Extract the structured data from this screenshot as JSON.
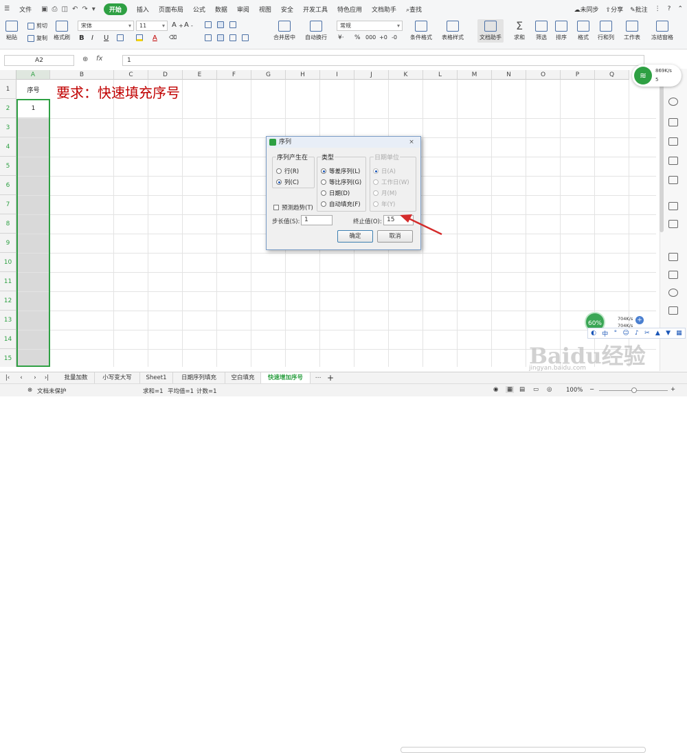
{
  "menubar": {
    "file": "文件",
    "tabs": [
      "开始",
      "插入",
      "页面布局",
      "公式",
      "数据",
      "审阅",
      "视图",
      "安全",
      "开发工具",
      "特色应用",
      "文档助手"
    ],
    "search": "查找",
    "right": [
      "未同步",
      "分享",
      "批注"
    ]
  },
  "ribbon": {
    "paste": "粘贴",
    "cut": "剪切",
    "copy": "复制",
    "format_painter": "格式刷",
    "font": "宋体",
    "size": "11",
    "merge": "合并居中",
    "wrap": "自动换行",
    "number_format": "常规",
    "cond_format": "条件格式",
    "table_style": "表格样式",
    "doc_helper": "文档助手",
    "sum": "求和",
    "filter": "筛选",
    "sort": "排序",
    "format": "格式",
    "rowcol": "行和列",
    "worksheet": "工作表",
    "freeze": "冻结窗格"
  },
  "formula": {
    "cell": "A2",
    "fx": "fx",
    "value": "1"
  },
  "grid": {
    "columns": [
      "A",
      "B",
      "C",
      "D",
      "E",
      "F",
      "G",
      "H",
      "I",
      "J",
      "K",
      "L",
      "M",
      "N",
      "O",
      "P",
      "Q"
    ],
    "rows": [
      "1",
      "2",
      "3",
      "4",
      "5",
      "6",
      "7",
      "8",
      "9",
      "10",
      "11",
      "12",
      "13",
      "14",
      "15"
    ],
    "a1": "序号",
    "a2": "1",
    "title": "要求：快速填充序号"
  },
  "dialog": {
    "title": "序列",
    "close": "×",
    "series_in": "序列产生在",
    "row": "行(R)",
    "col": "列(C)",
    "type": "类型",
    "linear": "等差序列(L)",
    "growth": "等比序列(G)",
    "date": "日期(D)",
    "autofill": "自动填充(F)",
    "date_unit": "日期单位",
    "day": "日(A)",
    "weekday": "工作日(W)",
    "month": "月(M)",
    "year": "年(Y)",
    "trend": "预测趋势(T)",
    "step_label": "步长值(S):",
    "step": "1",
    "stop_label": "终止值(O):",
    "stop": "15",
    "ok": "确定",
    "cancel": "取消"
  },
  "sheets": [
    "批量加数",
    "小写变大写",
    "Sheet1",
    "日期序列填充",
    "空白填充",
    "快速增加序号"
  ],
  "status": {
    "protect": "文档未保护",
    "sum": "求和=1",
    "avg": "平均值=1",
    "count": "计数=1",
    "zoom": "100%"
  },
  "network": {
    "up": "869K/s",
    "down": "5",
    "pct": "60%",
    "m1": "704K/s",
    "m2": "704K/s"
  },
  "watermark": {
    "brand": "Baidu经验",
    "url": "jingyan.baidu.com"
  },
  "colors": {
    "accent": "#2ea043",
    "title": "#c00000",
    "arrow": "#d42b2b"
  }
}
